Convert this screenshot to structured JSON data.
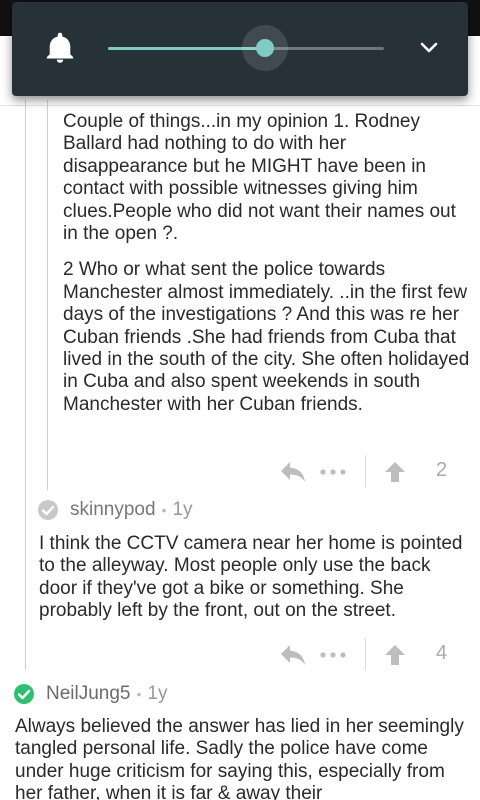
{
  "volume": {
    "level": 0.57,
    "accent_color": "#7fcbc4",
    "panel_color": "#263238",
    "bell_icon": "bell-icon",
    "expand_icon": "chevron-down-icon"
  },
  "comments": [
    {
      "paragraphs": [
        "Couple of things...in my opinion 1. Rodney Ballard had nothing to do with her disappearance but he MIGHT have been in contact with possible witnesses giving him clues.People who did not want their names out in the open ?.",
        "2 Who or what sent the police towards Manchester almost immediately. ..in the first few days of the investigations ? And this was re her Cuban friends .She had friends from Cuba that lived in the south of the city. She often holidayed in Cuba and also spent weekends in south Manchester with her Cuban friends."
      ],
      "upvotes": "2"
    },
    {
      "author": "skinnypod",
      "age": "1y",
      "verified_color": "#c8c8c8",
      "paragraphs": [
        "I think the CCTV camera near her home is pointed to the alleyway. Most people only use the back door if they've got a bike or something. She probably left by the front, out on the street."
      ],
      "upvotes": "4"
    },
    {
      "author": "NeilJung5",
      "age": "1y",
      "verified_color": "#2fbf71",
      "paragraphs": [
        "Always believed the answer has lied in her seemingly tangled personal life. Sadly the police have come under huge criticism for saying this, especially from her father, when it is far & away their"
      ]
    }
  ],
  "separator": "•"
}
